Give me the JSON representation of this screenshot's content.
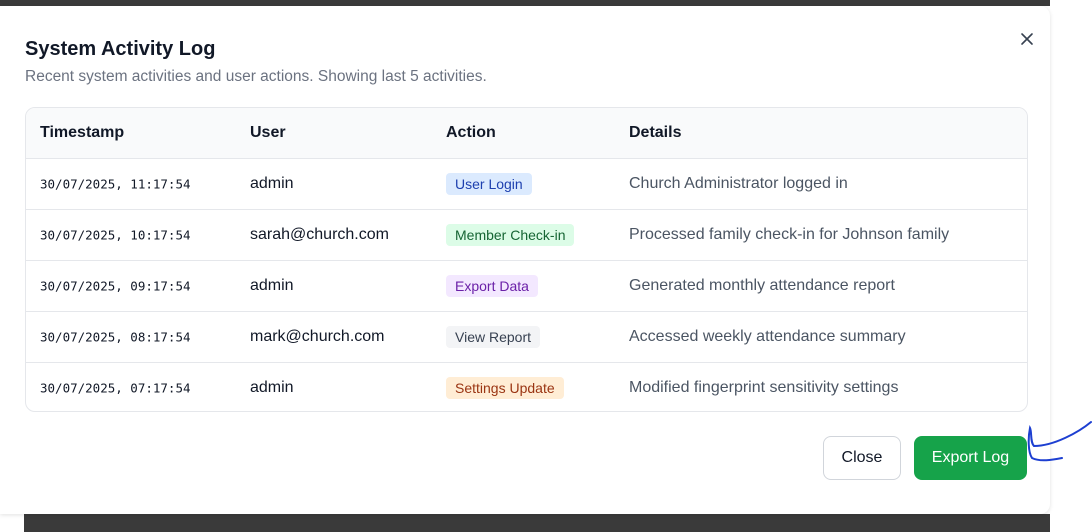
{
  "dialog": {
    "title": "System Activity Log",
    "subtitle": "Recent system activities and user actions. Showing last 5 activities."
  },
  "table": {
    "headers": [
      "Timestamp",
      "User",
      "Action",
      "Details"
    ],
    "rows": [
      {
        "timestamp": "30/07/2025, 11:17:54",
        "user": "admin",
        "action": "User Login",
        "details": "Church Administrator logged in"
      },
      {
        "timestamp": "30/07/2025, 10:17:54",
        "user": "sarah@church.com",
        "action": "Member Check-in",
        "details": "Processed family check-in for Johnson family"
      },
      {
        "timestamp": "30/07/2025, 09:17:54",
        "user": "admin",
        "action": "Export Data",
        "details": "Generated monthly attendance report"
      },
      {
        "timestamp": "30/07/2025, 08:17:54",
        "user": "mark@church.com",
        "action": "View Report",
        "details": "Accessed weekly attendance summary"
      },
      {
        "timestamp": "30/07/2025, 07:17:54",
        "user": "admin",
        "action": "Settings Update",
        "details": "Modified fingerprint sensitivity settings"
      }
    ]
  },
  "badge_colors": {
    "User Login": {
      "bg": "#dbeafe",
      "fg": "#1e40af"
    },
    "Member Check-in": {
      "bg": "#dcfce7",
      "fg": "#166534"
    },
    "Export Data": {
      "bg": "#f3e8ff",
      "fg": "#6b21a8"
    },
    "View Report": {
      "bg": "#f3f4f6",
      "fg": "#374151"
    },
    "Settings Update": {
      "bg": "#ffedd5",
      "fg": "#9a3412"
    }
  },
  "footer": {
    "close_label": "Close",
    "export_label": "Export Log"
  },
  "colors": {
    "accent": "#16a34a",
    "annotation": "#1d3fd1"
  },
  "icons": {
    "close": "close-icon"
  }
}
